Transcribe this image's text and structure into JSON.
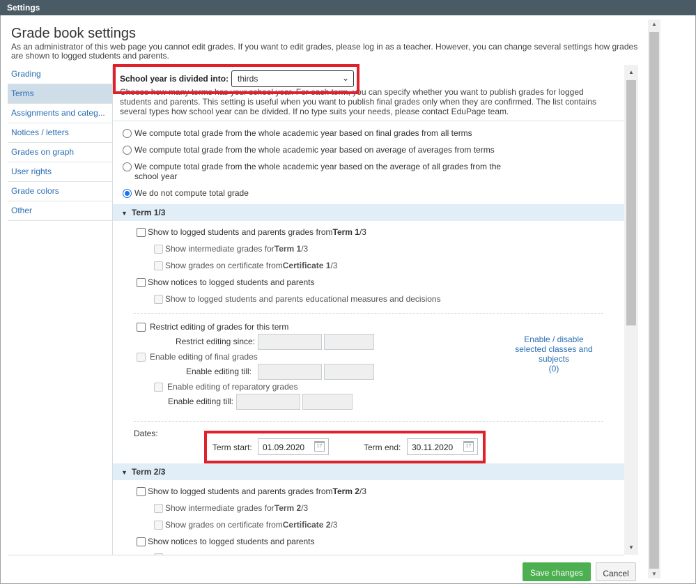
{
  "window": {
    "title": "Settings"
  },
  "page": {
    "title": "Grade book settings",
    "intro": "As an administrator of this web page you cannot edit grades. If you want to edit grades, please log in as a teacher. However, you can change several settings how grades are shown to logged students and parents."
  },
  "sidebar": {
    "items": [
      {
        "label": "Grading"
      },
      {
        "label": "Terms"
      },
      {
        "label": "Assignments and categ..."
      },
      {
        "label": "Notices / letters"
      },
      {
        "label": "Grades on graph"
      },
      {
        "label": "User rights"
      },
      {
        "label": "Grade colors"
      },
      {
        "label": "Other"
      }
    ],
    "active": "Terms"
  },
  "school_year": {
    "label": "School year is divided into:",
    "selected": "thirds",
    "description": "Choose how many terms has your school year. For each term, you can specify whether you want to publish grades for logged students and parents. This setting is useful when you want to publish final grades only when they are confirmed. The list contains several types how school year can be divided. If no type suits your needs, please contact EduPage team."
  },
  "total_grade": {
    "options": [
      "We compute total grade from the whole academic year based on final grades from all terms",
      "We compute total grade from the whole academic year based on average of averages from terms",
      "We compute total grade from the whole academic year based on the average of all grades from the school year",
      "We do not compute total grade"
    ],
    "selected_index": 3
  },
  "term1": {
    "header": "Term 1/3",
    "show_grades_pre": "Show to logged students and parents grades from ",
    "show_grades_bold": "Term 1",
    "show_grades_post": "/3",
    "intermediate_pre": "Show intermediate grades for ",
    "intermediate_bold": "Term 1",
    "intermediate_post": "/3",
    "certificate_pre": "Show grades on certificate from ",
    "certificate_bold": "Certificate 1",
    "certificate_post": "/3",
    "notices": "Show notices to logged students and parents",
    "measures": "Show to logged students and parents educational measures and decisions",
    "restrict": "Restrict editing of grades for this term",
    "restrict_since": "Restrict editing since:",
    "enable_final": "Enable editing of final grades",
    "enable_till_1": "Enable editing till:",
    "enable_reparatory": "Enable editing of reparatory grades",
    "enable_till_2": "Enable editing till:",
    "link_line1": "Enable / disable",
    "link_line2": "selected classes and",
    "link_line3": "subjects",
    "link_count": "(0)",
    "dates_label": "Dates:",
    "term_start_label": "Term start:",
    "term_start": "01.09.2020",
    "term_end_label": "Term end:",
    "term_end": "30.11.2020"
  },
  "term2": {
    "header": "Term 2/3",
    "show_grades_pre": "Show to logged students and parents grades from ",
    "show_grades_bold": "Term 2",
    "show_grades_post": "/3",
    "intermediate_pre": "Show intermediate grades for ",
    "intermediate_bold": "Term 2",
    "intermediate_post": "/3",
    "certificate_pre": "Show grades on certificate from ",
    "certificate_bold": "Certificate 2",
    "certificate_post": "/3",
    "notices": "Show notices to logged students and parents"
  },
  "footer": {
    "save": "Save changes",
    "cancel": "Cancel"
  },
  "colors": {
    "highlight": "#e0202b",
    "save_button": "#4caf50",
    "link": "#2a6eb2",
    "titlebar": "#4a5b66"
  },
  "icons": [
    "chevron-down-icon",
    "triangle-down-icon",
    "calendar-icon"
  ]
}
